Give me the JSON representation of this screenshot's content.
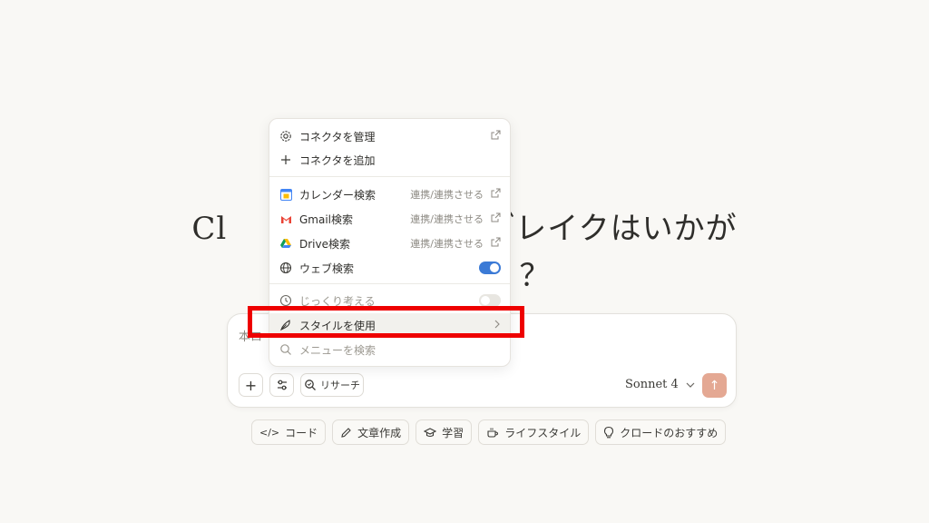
{
  "headline": {
    "line1_left": "Cl",
    "line1_right": "ブレイクはいかが",
    "line2": "？"
  },
  "chat": {
    "placeholder": "本ロ"
  },
  "toolbar": {
    "add_label": "+",
    "research_label": "リサーチ",
    "model_label": "Sonnet 4",
    "send_symbol": "↑"
  },
  "menu": {
    "manage_connectors": "コネクタを管理",
    "add_connector": "コネクタを追加",
    "calendar_search": "カレンダー検索",
    "calendar_status": "連携/連携させる",
    "gmail_search": "Gmail検索",
    "gmail_status": "連携/連携させる",
    "drive_search": "Drive検索",
    "drive_status": "連携/連携させる",
    "web_search": "ウェブ検索",
    "web_search_enabled": true,
    "deep_think": "じっくり考える",
    "deep_think_enabled": false,
    "use_style": "スタイルを使用",
    "search_menu": "メニューを検索"
  },
  "chips": [
    {
      "label": "コード",
      "icon": "code-icon"
    },
    {
      "label": "文章作成",
      "icon": "pencil-icon"
    },
    {
      "label": "学習",
      "icon": "graduation-cap-icon"
    },
    {
      "label": "ライフスタイル",
      "icon": "coffee-icon"
    },
    {
      "label": "クロードのおすすめ",
      "icon": "lightbulb-icon"
    }
  ],
  "colors": {
    "accent": "#3b7ad6",
    "send_button": "#e4a893",
    "highlight": "#ee0000",
    "background": "#f9f8f5"
  }
}
